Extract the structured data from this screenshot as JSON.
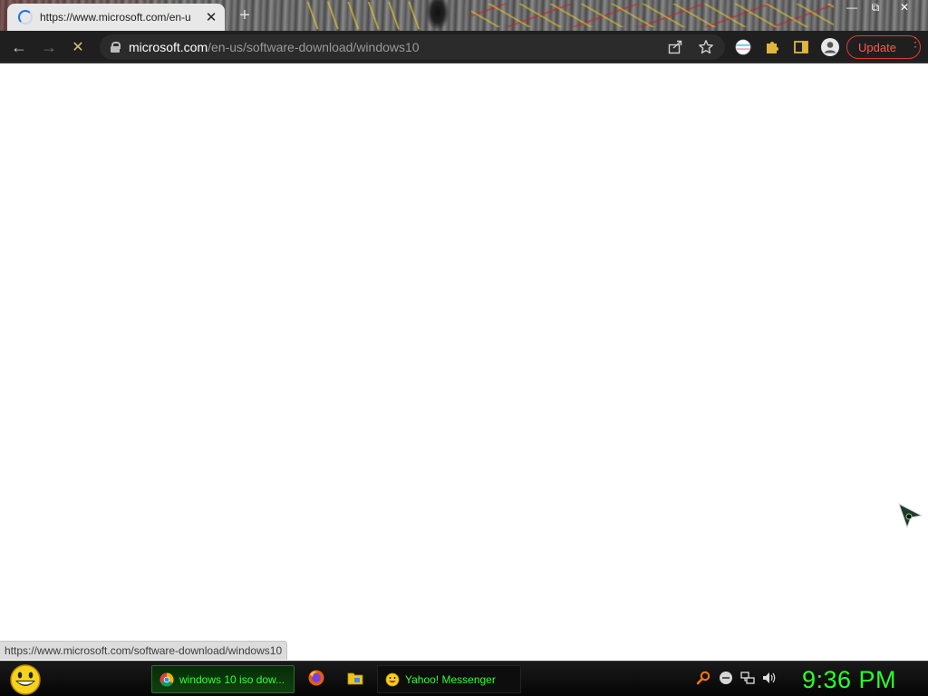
{
  "browser": {
    "tab": {
      "title": "https://www.microsoft.com/en-u",
      "close_glyph": "✕"
    },
    "new_tab_glyph": "+",
    "window_controls": {
      "minimize": "—",
      "restore": "⧉",
      "close": "✕"
    },
    "nav": {
      "back_glyph": "←",
      "forward_glyph": "→",
      "stop_glyph": "✕"
    },
    "omnibox": {
      "host": "microsoft.com",
      "path": "/en-us/software-download/windows10"
    },
    "update_label": "Update",
    "menu_glyph": "⋮",
    "status_url": "https://www.microsoft.com/software-download/windows10"
  },
  "taskbar": {
    "tasks": [
      {
        "label": "windows 10 iso dow...",
        "icon": "chrome-icon",
        "active": true
      },
      {
        "label": "Yahoo! Messenger",
        "icon": "yahoo-messenger-icon",
        "active": false
      }
    ],
    "quick_launch": [
      "firefox-icon",
      "folder-icon"
    ],
    "tray": [
      "search-icon",
      "network-icon",
      "connection-icon",
      "volume-icon"
    ],
    "clock": "9:36 PM"
  },
  "colors": {
    "update_accent": "#e53935",
    "taskbar_text": "#33ff33",
    "clock": "#2bff2b",
    "loading_spinner": "#1a73e8"
  }
}
